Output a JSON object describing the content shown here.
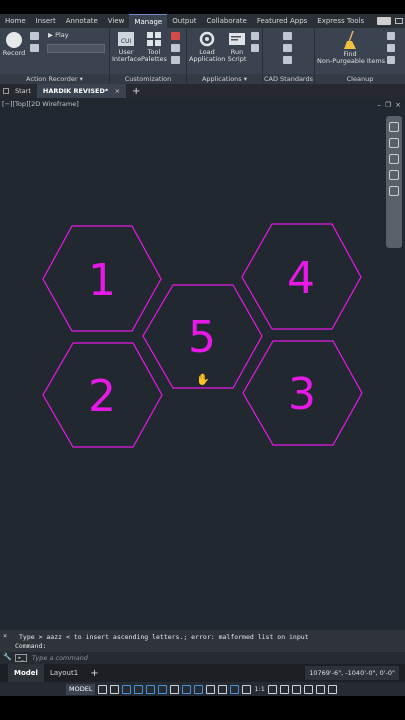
{
  "ribbon_tabs": [
    {
      "label": "Home",
      "active": false
    },
    {
      "label": "Insert",
      "active": false
    },
    {
      "label": "Annotate",
      "active": false
    },
    {
      "label": "View",
      "active": false
    },
    {
      "label": "Manage",
      "active": true
    },
    {
      "label": "Output",
      "active": false
    },
    {
      "label": "Collaborate",
      "active": false
    },
    {
      "label": "Featured Apps",
      "active": false
    },
    {
      "label": "Express Tools",
      "active": false
    }
  ],
  "ribbon": {
    "record_label": "Record",
    "play_label": "Play",
    "action_recorder_label": "Action Recorder",
    "user_interface_label": "User Interface",
    "user_interface_line1": "User",
    "user_interface_line2": "Interface",
    "cui_badge": "CUI",
    "tool_palettes_line1": "Tool",
    "tool_palettes_line2": "Palettes",
    "customization_label": "Customization",
    "load_application_line1": "Load",
    "load_application_line2": "Application",
    "run_script_line1": "Run",
    "run_script_line2": "Script",
    "applications_label": "Applications",
    "cad_standards_label": "CAD Standards",
    "find_line1": "Find",
    "find_line2": "Non-Purgeable Items",
    "cleanup_label": "Cleanup"
  },
  "file_tabs": {
    "start_label": "Start",
    "current_file": "HARDIK REVISED*",
    "close_glyph": "×",
    "add_glyph": "+"
  },
  "viewport": {
    "label": "[−][Top][2D Wireframe]",
    "minimize": "–",
    "restore": "❐",
    "close": "×"
  },
  "drawing": {
    "color": "#e619e6",
    "hexagons": [
      {
        "label": "1"
      },
      {
        "label": "4"
      },
      {
        "label": "5"
      },
      {
        "label": "2"
      },
      {
        "label": "3"
      }
    ]
  },
  "command": {
    "history_line": "Type > aazz < to insert ascending letters.; error: malformed list on input",
    "command_prefix": "Command:",
    "input_placeholder": "Type a command",
    "close_glyph": "×",
    "tool_glyph": "🔧"
  },
  "layout_tabs": [
    {
      "label": "Model",
      "active": true
    },
    {
      "label": "Layout1",
      "active": false
    }
  ],
  "layout_add": "+",
  "coordinates": "10769'-6\", -1040'-0\", 0'-0\"",
  "status": {
    "model_label": "MODEL",
    "scale_label": "1:1"
  }
}
